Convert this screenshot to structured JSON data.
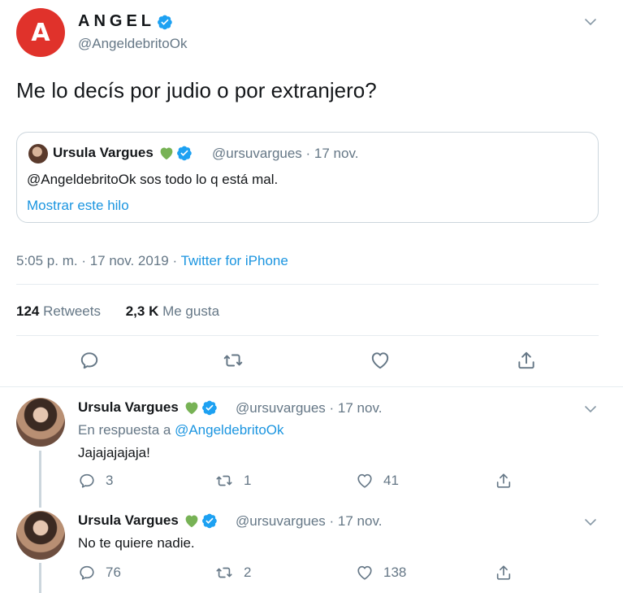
{
  "main_tweet": {
    "avatar_letter": "A",
    "display_name": "ANGEL",
    "handle": "@AngeldebritoOk",
    "text": "Me lo decís por judio o por extranjero?",
    "meta": "5:05 p. m. · 17 nov. 2019 · ",
    "source": "Twitter for iPhone",
    "retweets_count": "124",
    "retweets_label": "Retweets",
    "likes_count": "2,3 K",
    "likes_label": "Me gusta"
  },
  "quoted_tweet": {
    "display_name": "Ursula Vargues",
    "heart_emoji": "💚",
    "handle_date": "@ursuvargues · 17 nov.",
    "text": "@AngeldebritoOk sos todo lo q está mal.",
    "show_thread": "Mostrar este hilo"
  },
  "replies": [
    {
      "display_name": "Ursula Vargues",
      "handle_date": "@ursuvargues · 17 nov.",
      "reply_prefix": "En respuesta a ",
      "reply_to": "@AngeldebritoOk",
      "text": "Jajajajajaja!",
      "replies_count": "3",
      "retweets_count": "1",
      "likes_count": "41"
    },
    {
      "display_name": "Ursula Vargues",
      "handle_date": "@ursuvargues · 17 nov.",
      "text": "No te quiere nadie.",
      "replies_count": "76",
      "retweets_count": "2",
      "likes_count": "138"
    }
  ],
  "colors": {
    "accent": "#1b95e0",
    "avatar_red": "#e0322b",
    "muted": "#657786",
    "border": "#ccd6dd",
    "green_heart": "#77b255"
  },
  "icons": [
    "chevron-down-icon",
    "verified-badge-icon",
    "green-heart-icon",
    "reply-icon",
    "retweet-icon",
    "like-icon",
    "share-icon"
  ]
}
